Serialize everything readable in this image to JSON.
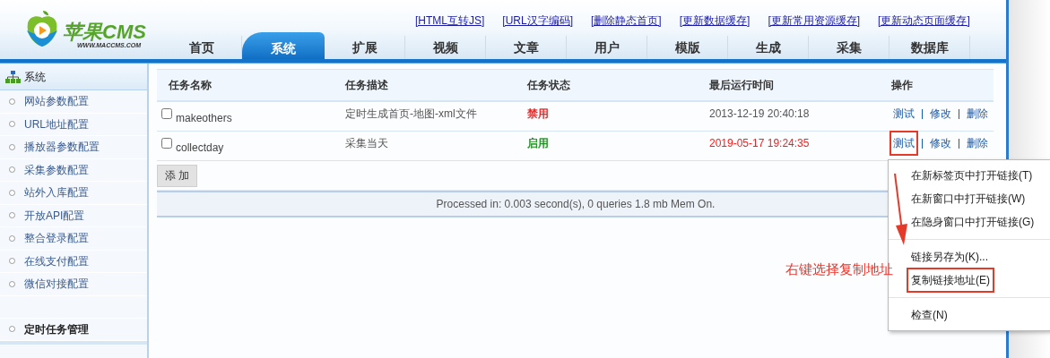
{
  "header": {
    "logo": {
      "title": "苹果CMS",
      "subtitle": "WWW.MACCMS.COM"
    },
    "quick_links": [
      "[HTML互转JS]",
      "[URL汉字编码]",
      "[删除静态首页]",
      "[更新数据缓存]",
      "[更新常用资源缓存]",
      "[更新动态页面缓存]"
    ],
    "nav_tabs": [
      {
        "label": "首页",
        "selected": false
      },
      {
        "label": "系统",
        "selected": true
      },
      {
        "label": "扩展",
        "selected": false
      },
      {
        "label": "视频",
        "selected": false
      },
      {
        "label": "文章",
        "selected": false
      },
      {
        "label": "用户",
        "selected": false
      },
      {
        "label": "模版",
        "selected": false
      },
      {
        "label": "生成",
        "selected": false
      },
      {
        "label": "采集",
        "selected": false
      },
      {
        "label": "数据库",
        "selected": false
      }
    ]
  },
  "sidebar": {
    "title": "系统",
    "items": [
      {
        "label": "网站参数配置",
        "selected": false
      },
      {
        "label": "URL地址配置",
        "selected": false
      },
      {
        "label": "播放器参数配置",
        "selected": false
      },
      {
        "label": "采集参数配置",
        "selected": false
      },
      {
        "label": "站外入库配置",
        "selected": false
      },
      {
        "label": "开放API配置",
        "selected": false
      },
      {
        "label": "整合登录配置",
        "selected": false
      },
      {
        "label": "在线支付配置",
        "selected": false
      },
      {
        "label": "微信对接配置",
        "selected": false
      }
    ],
    "bottom_items": [
      {
        "label": "定时任务管理",
        "selected": true
      }
    ]
  },
  "table": {
    "columns": [
      "任务名称",
      "任务描述",
      "任务状态",
      "最后运行时间",
      "操作"
    ],
    "rows": [
      {
        "checked": false,
        "name": "makeothers",
        "description": "定时生成首页-地图-xml文件",
        "status": "禁用",
        "color": "#e51c1c",
        "last_run": "2013-12-19 20:40:18",
        "last_run_highlighted": false,
        "actions": [
          {
            "label": "测试",
            "marked": false
          },
          {
            "label": "修改",
            "marked": false
          },
          {
            "label": "删除",
            "marked": false
          }
        ]
      },
      {
        "checked": false,
        "name": "collectday",
        "description": "采集当天",
        "status": "启用",
        "color": "#198a19",
        "last_run": "2019-05-17 19:24:35",
        "last_run_highlighted": true,
        "actions": [
          {
            "label": "测试",
            "marked": true
          },
          {
            "label": "修改",
            "marked": false
          },
          {
            "label": "删除",
            "marked": false
          }
        ]
      }
    ]
  },
  "add_button": "添 加",
  "footer": "Processed in: 0.003 second(s), 0 queries 1.8 mb Mem On.",
  "context_menu": {
    "groups": [
      [
        {
          "label": "在新标签页中打开链接(T)",
          "marked": false
        },
        {
          "label": "在新窗口中打开链接(W)",
          "marked": false
        },
        {
          "label": "在隐身窗口中打开链接(G)",
          "marked": false
        }
      ],
      [
        {
          "label": "链接另存为(K)...",
          "marked": false
        },
        {
          "label": "复制链接地址(E)",
          "marked": true
        }
      ],
      [
        {
          "label": "检查(N)",
          "marked": false
        }
      ]
    ]
  },
  "annotation": {
    "text": "右键选择复制地址"
  }
}
